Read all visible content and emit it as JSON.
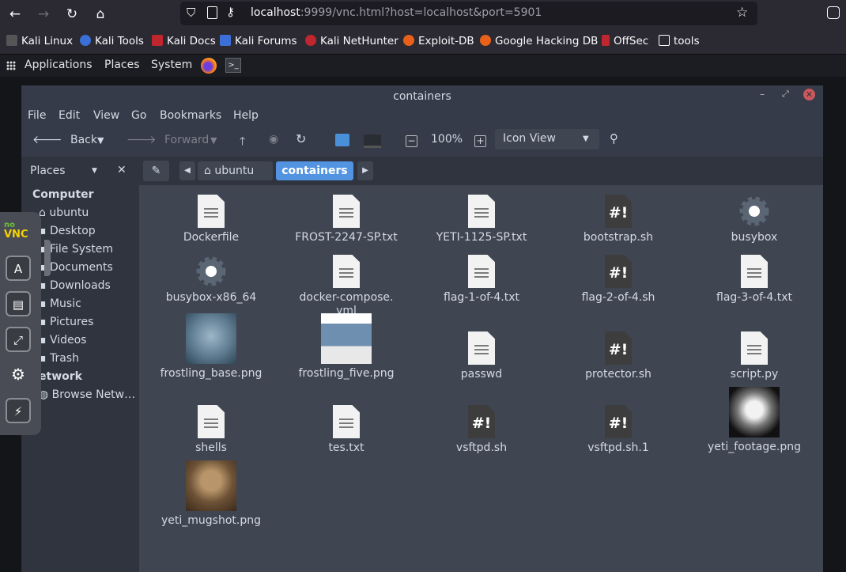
{
  "browser": {
    "url_host": "localhost",
    "url_rest": ":9999/vnc.html?host=localhost&port=5901",
    "bookmarks": [
      "Kali Linux",
      "Kali Tools",
      "Kali Docs",
      "Kali Forums",
      "Kali NetHunter",
      "Exploit-DB",
      "Google Hacking DB",
      "OffSec",
      "tools"
    ]
  },
  "panel": {
    "applications": "Applications",
    "places": "Places",
    "system": "System"
  },
  "window": {
    "title": "containers",
    "menu": [
      "File",
      "Edit",
      "View",
      "Go",
      "Bookmarks",
      "Help"
    ],
    "toolbar": {
      "back": "Back",
      "forward": "Forward",
      "zoom": "100%",
      "view_mode": "Icon View"
    },
    "places_label": "Places",
    "breadcrumb": [
      "ubuntu",
      "containers"
    ]
  },
  "sidebar": {
    "computer_header": "Computer",
    "computer_items": [
      "ubuntu",
      "Desktop",
      "File System",
      "Documents",
      "Downloads",
      "Music",
      "Pictures",
      "Videos",
      "Trash"
    ],
    "network_header": "etwork",
    "network_items": [
      "Browse Netw…"
    ]
  },
  "files": [
    {
      "name": "Dockerfile",
      "kind": "text"
    },
    {
      "name": "FROST-2247-SP.txt",
      "kind": "text"
    },
    {
      "name": "YETI-1125-SP.txt",
      "kind": "text"
    },
    {
      "name": "bootstrap.sh",
      "kind": "script"
    },
    {
      "name": "busybox",
      "kind": "executable"
    },
    {
      "name": "busybox-x86_64",
      "kind": "executable"
    },
    {
      "name": "docker-compose.\nyml",
      "kind": "text"
    },
    {
      "name": "flag-1-of-4.txt",
      "kind": "text"
    },
    {
      "name": "flag-2-of-4.sh",
      "kind": "script"
    },
    {
      "name": "flag-3-of-4.txt",
      "kind": "text"
    },
    {
      "name": "frostling_base.png",
      "kind": "image-blue"
    },
    {
      "name": "frostling_five.png",
      "kind": "image-wanted"
    },
    {
      "name": "passwd",
      "kind": "text"
    },
    {
      "name": "protector.sh",
      "kind": "script"
    },
    {
      "name": "script.py",
      "kind": "text"
    },
    {
      "name": "shells",
      "kind": "text"
    },
    {
      "name": "tes.txt",
      "kind": "text"
    },
    {
      "name": "vsftpd.sh",
      "kind": "script"
    },
    {
      "name": "vsftpd.sh.1",
      "kind": "script"
    },
    {
      "name": "yeti_footage.png",
      "kind": "image-bw"
    },
    {
      "name": "yeti_mugshot.png",
      "kind": "image-sepia"
    }
  ],
  "novnc": {
    "logo_top": "no",
    "logo_bottom": "VNC"
  }
}
